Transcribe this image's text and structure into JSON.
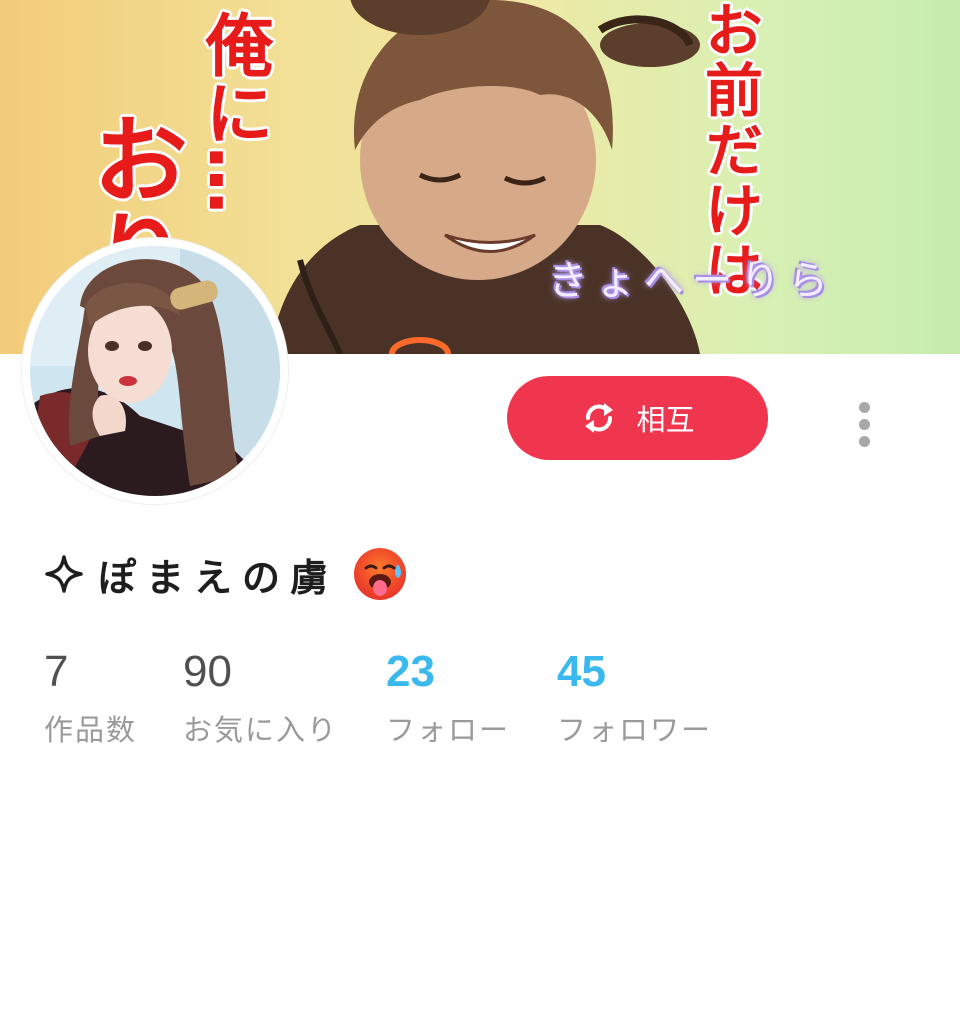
{
  "banner": {
    "caption_right": "お前だけは",
    "caption_left": "俺に…",
    "caption_big": "おり",
    "signature": "きょへーりら"
  },
  "profile": {
    "name": "ぽまえの虜",
    "name_prefix_icon": "sparkle-icon",
    "name_suffix_icon": "hot-face-emoji-icon"
  },
  "actions": {
    "mutual_label": "相互",
    "mutual_icon": "refresh-arrows-icon",
    "more_icon": "vertical-dots-icon"
  },
  "stats": {
    "works": {
      "value": "7",
      "label": "作品数"
    },
    "favorites": {
      "value": "90",
      "label": "お気に入り"
    },
    "following": {
      "value": "23",
      "label": "フォロー"
    },
    "followers": {
      "value": "45",
      "label": "フォロワー"
    }
  },
  "colors": {
    "accent_red": "#f0354f",
    "accent_blue": "#3bb9ee",
    "banner_text_red": "#e81b1b"
  }
}
